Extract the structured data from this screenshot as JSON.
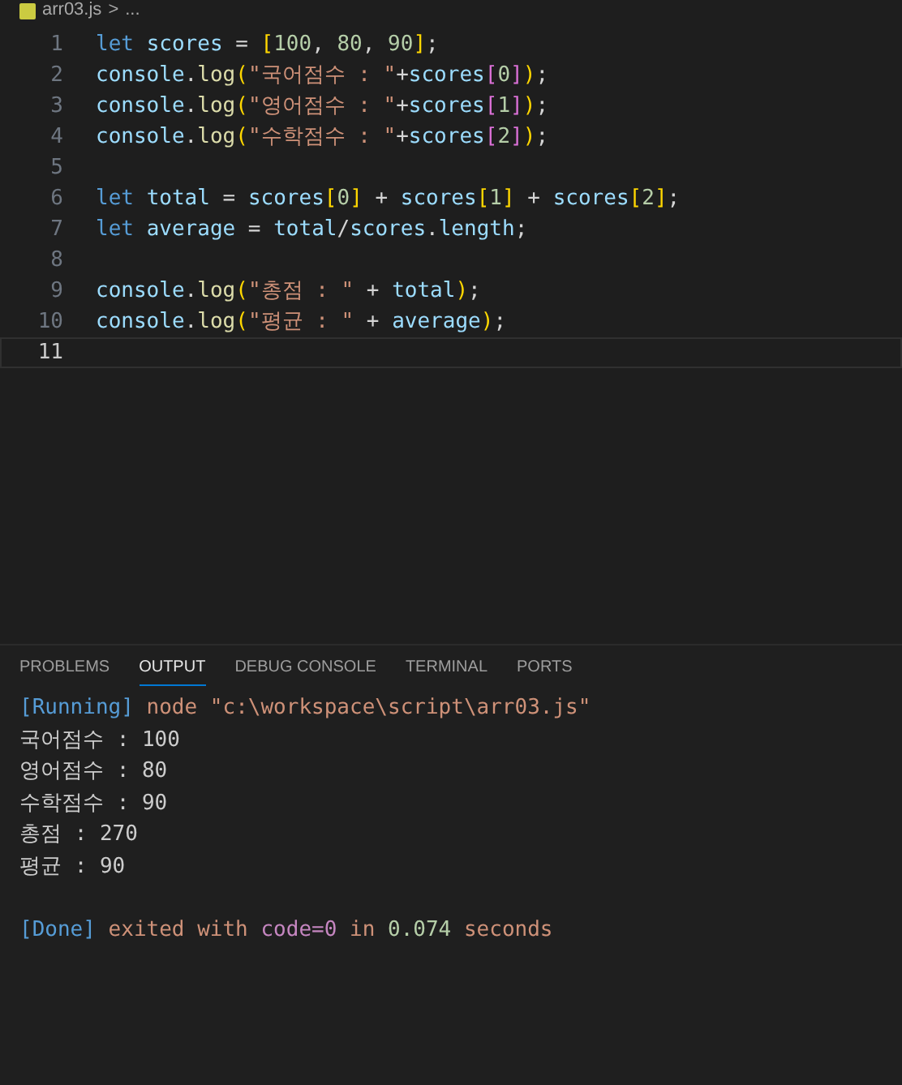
{
  "breadcrumb": {
    "file": "arr03.js",
    "separator": ">",
    "rest": "..."
  },
  "code_lines": [
    {
      "number": "1",
      "current": false,
      "tokens": [
        {
          "kind": "keyword",
          "text": "let "
        },
        {
          "kind": "variable",
          "text": "scores"
        },
        {
          "kind": "plain",
          "text": " = "
        },
        {
          "kind": "bracket1",
          "text": "["
        },
        {
          "kind": "number",
          "text": "100"
        },
        {
          "kind": "plain",
          "text": ", "
        },
        {
          "kind": "number",
          "text": "80"
        },
        {
          "kind": "plain",
          "text": ", "
        },
        {
          "kind": "number",
          "text": "90"
        },
        {
          "kind": "bracket1",
          "text": "]"
        },
        {
          "kind": "plain",
          "text": ";"
        }
      ]
    },
    {
      "number": "2",
      "current": false,
      "tokens": [
        {
          "kind": "variable",
          "text": "console"
        },
        {
          "kind": "plain",
          "text": "."
        },
        {
          "kind": "function",
          "text": "log"
        },
        {
          "kind": "bracket1",
          "text": "("
        },
        {
          "kind": "string",
          "text": "\"국어점수 : \""
        },
        {
          "kind": "plain",
          "text": "+"
        },
        {
          "kind": "variable",
          "text": "scores"
        },
        {
          "kind": "bracket2",
          "text": "["
        },
        {
          "kind": "number",
          "text": "0"
        },
        {
          "kind": "bracket2",
          "text": "]"
        },
        {
          "kind": "bracket1",
          "text": ")"
        },
        {
          "kind": "plain",
          "text": ";"
        }
      ]
    },
    {
      "number": "3",
      "current": false,
      "tokens": [
        {
          "kind": "variable",
          "text": "console"
        },
        {
          "kind": "plain",
          "text": "."
        },
        {
          "kind": "function",
          "text": "log"
        },
        {
          "kind": "bracket1",
          "text": "("
        },
        {
          "kind": "string",
          "text": "\"영어점수 : \""
        },
        {
          "kind": "plain",
          "text": "+"
        },
        {
          "kind": "variable",
          "text": "scores"
        },
        {
          "kind": "bracket2",
          "text": "["
        },
        {
          "kind": "number",
          "text": "1"
        },
        {
          "kind": "bracket2",
          "text": "]"
        },
        {
          "kind": "bracket1",
          "text": ")"
        },
        {
          "kind": "plain",
          "text": ";"
        }
      ]
    },
    {
      "number": "4",
      "current": false,
      "tokens": [
        {
          "kind": "variable",
          "text": "console"
        },
        {
          "kind": "plain",
          "text": "."
        },
        {
          "kind": "function",
          "text": "log"
        },
        {
          "kind": "bracket1",
          "text": "("
        },
        {
          "kind": "string",
          "text": "\"수학점수 : \""
        },
        {
          "kind": "plain",
          "text": "+"
        },
        {
          "kind": "variable",
          "text": "scores"
        },
        {
          "kind": "bracket2",
          "text": "["
        },
        {
          "kind": "number",
          "text": "2"
        },
        {
          "kind": "bracket2",
          "text": "]"
        },
        {
          "kind": "bracket1",
          "text": ")"
        },
        {
          "kind": "plain",
          "text": ";"
        }
      ]
    },
    {
      "number": "5",
      "current": false
    },
    {
      "number": "6",
      "current": false,
      "tokens": [
        {
          "kind": "keyword",
          "text": "let "
        },
        {
          "kind": "variable",
          "text": "total"
        },
        {
          "kind": "plain",
          "text": " = "
        },
        {
          "kind": "variable",
          "text": "scores"
        },
        {
          "kind": "bracket1",
          "text": "["
        },
        {
          "kind": "number",
          "text": "0"
        },
        {
          "kind": "bracket1",
          "text": "]"
        },
        {
          "kind": "plain",
          "text": " + "
        },
        {
          "kind": "variable",
          "text": "scores"
        },
        {
          "kind": "bracket1",
          "text": "["
        },
        {
          "kind": "number",
          "text": "1"
        },
        {
          "kind": "bracket1",
          "text": "]"
        },
        {
          "kind": "plain",
          "text": " + "
        },
        {
          "kind": "variable",
          "text": "scores"
        },
        {
          "kind": "bracket1",
          "text": "["
        },
        {
          "kind": "number",
          "text": "2"
        },
        {
          "kind": "bracket1",
          "text": "]"
        },
        {
          "kind": "plain",
          "text": ";"
        }
      ]
    },
    {
      "number": "7",
      "current": false,
      "tokens": [
        {
          "kind": "keyword",
          "text": "let "
        },
        {
          "kind": "variable",
          "text": "average"
        },
        {
          "kind": "plain",
          "text": " = "
        },
        {
          "kind": "variable",
          "text": "total"
        },
        {
          "kind": "plain",
          "text": "/"
        },
        {
          "kind": "variable",
          "text": "scores"
        },
        {
          "kind": "plain",
          "text": "."
        },
        {
          "kind": "variable",
          "text": "length"
        },
        {
          "kind": "plain",
          "text": ";"
        }
      ]
    },
    {
      "number": "8",
      "current": false
    },
    {
      "number": "9",
      "current": false,
      "tokens": [
        {
          "kind": "variable",
          "text": "console"
        },
        {
          "kind": "plain",
          "text": "."
        },
        {
          "kind": "function",
          "text": "log"
        },
        {
          "kind": "bracket1",
          "text": "("
        },
        {
          "kind": "string",
          "text": "\"총점 : \""
        },
        {
          "kind": "plain",
          "text": " + "
        },
        {
          "kind": "variable",
          "text": "total"
        },
        {
          "kind": "bracket1",
          "text": ")"
        },
        {
          "kind": "plain",
          "text": ";"
        }
      ]
    },
    {
      "number": "10",
      "current": false,
      "tokens": [
        {
          "kind": "variable",
          "text": "console"
        },
        {
          "kind": "plain",
          "text": "."
        },
        {
          "kind": "function",
          "text": "log"
        },
        {
          "kind": "bracket1",
          "text": "("
        },
        {
          "kind": "string",
          "text": "\"평균 : \""
        },
        {
          "kind": "plain",
          "text": " + "
        },
        {
          "kind": "variable",
          "text": "average"
        },
        {
          "kind": "bracket1",
          "text": ")"
        },
        {
          "kind": "plain",
          "text": ";"
        }
      ]
    },
    {
      "number": "11",
      "current": true
    }
  ],
  "panel_tabs": [
    {
      "label": "PROBLEMS",
      "selected": false
    },
    {
      "label": "OUTPUT",
      "selected": true
    },
    {
      "label": "DEBUG CONSOLE",
      "selected": false
    },
    {
      "label": "TERMINAL",
      "selected": false
    },
    {
      "label": "PORTS",
      "selected": false
    }
  ],
  "output_lines": [
    {
      "segments": [
        {
          "kind": "tag",
          "text": "[Running]"
        },
        {
          "kind": "info",
          "text": " node \"c:\\workspace\\script\\arr03.js\""
        }
      ]
    },
    {
      "segments": [
        {
          "kind": "plain",
          "text": "국어점수 : 100"
        }
      ]
    },
    {
      "segments": [
        {
          "kind": "plain",
          "text": "영어점수 : 80"
        }
      ]
    },
    {
      "segments": [
        {
          "kind": "plain",
          "text": "수학점수 : 90"
        }
      ]
    },
    {
      "segments": [
        {
          "kind": "plain",
          "text": "총점 : 270"
        }
      ]
    },
    {
      "segments": [
        {
          "kind": "plain",
          "text": "평균 : 90"
        }
      ]
    },
    {
      "gap_before": true,
      "segments": [
        {
          "kind": "tag",
          "text": "[Done]"
        },
        {
          "kind": "info",
          "text": " exited with "
        },
        {
          "kind": "code",
          "text": "code=0"
        },
        {
          "kind": "info",
          "text": " in "
        },
        {
          "kind": "number",
          "text": "0.074"
        },
        {
          "kind": "info",
          "text": " seconds"
        }
      ]
    }
  ]
}
